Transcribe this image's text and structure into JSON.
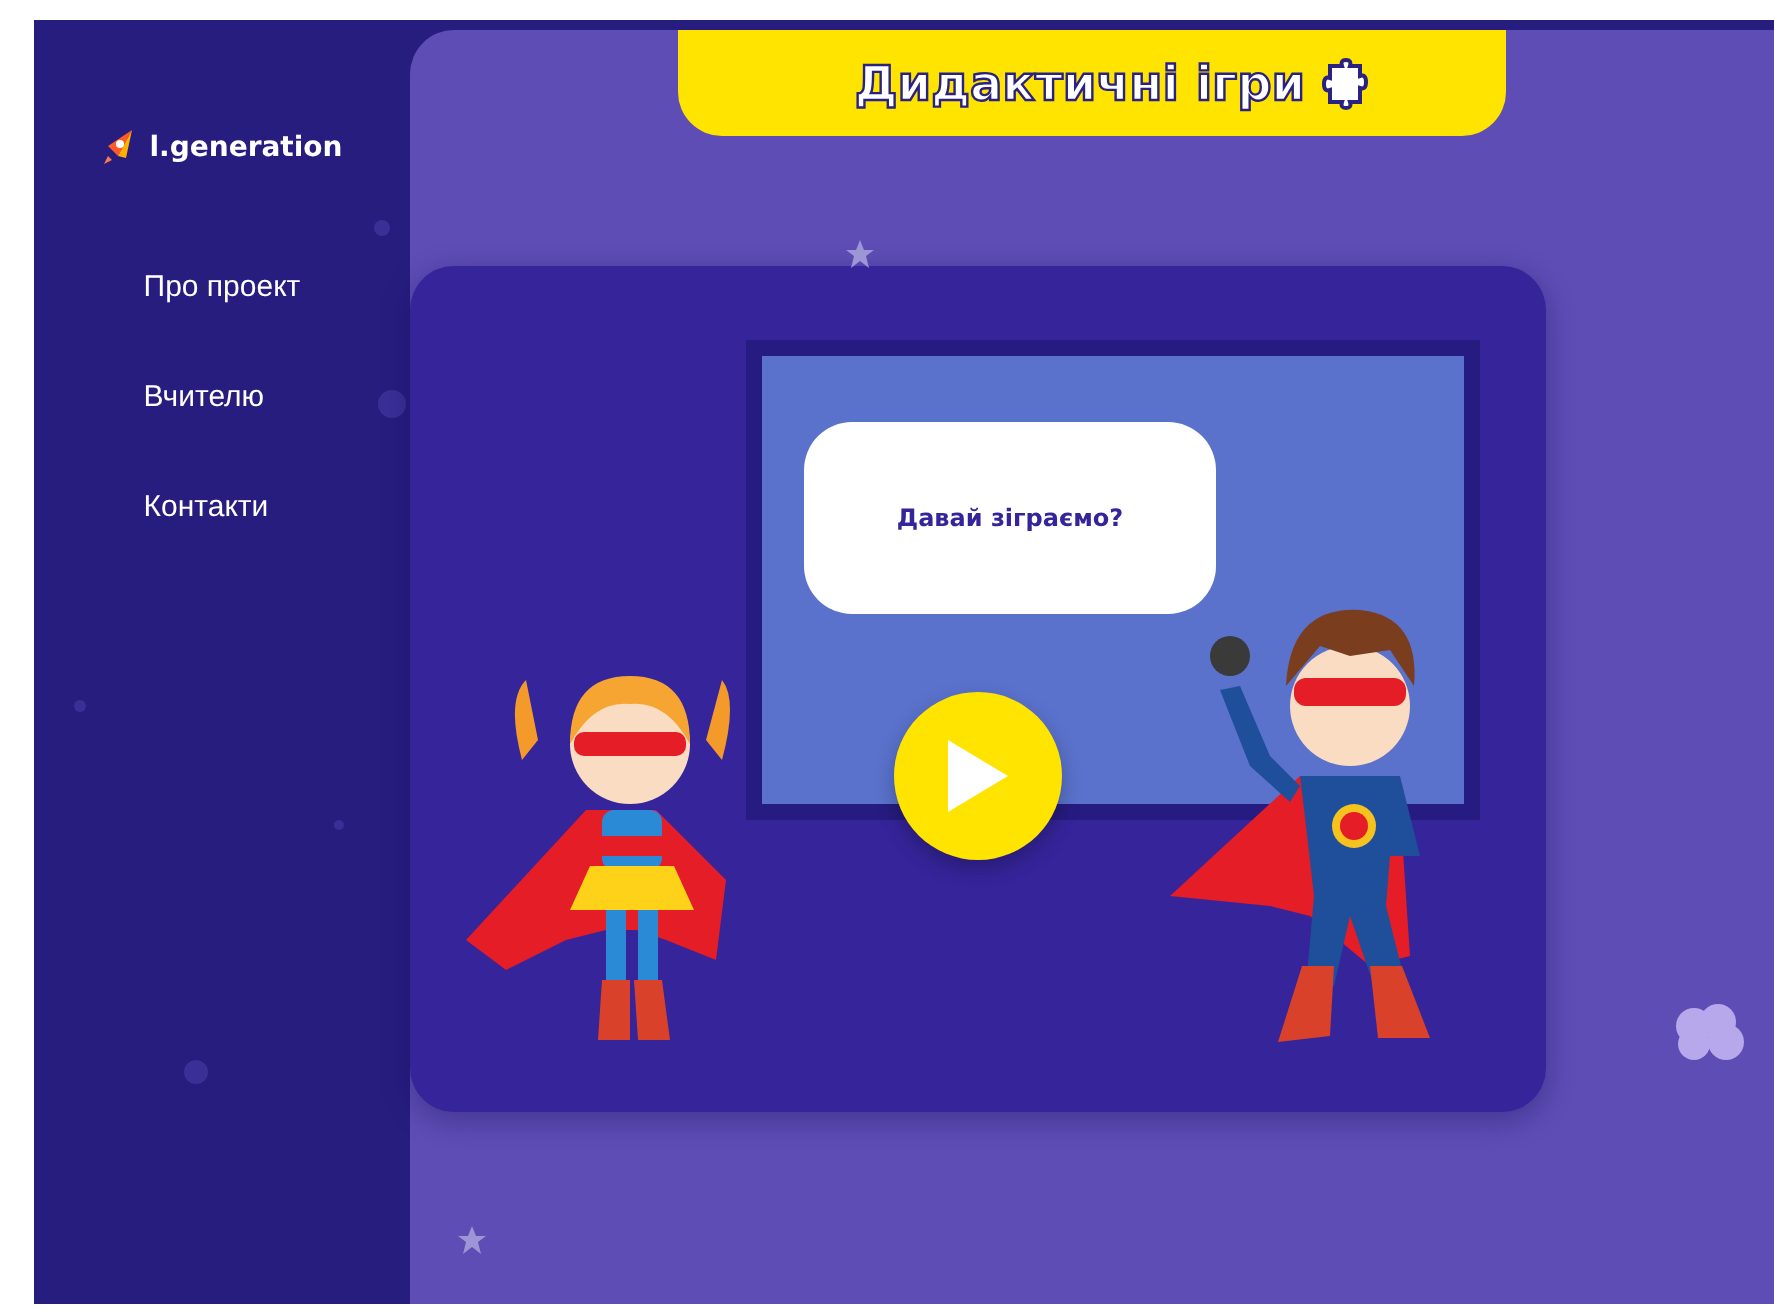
{
  "sidebar": {
    "logo": {
      "text": "l.generation"
    },
    "items": [
      {
        "label": "Про проект"
      },
      {
        "label": "Вчителю"
      },
      {
        "label": "Контакти"
      }
    ]
  },
  "header": {
    "title": "Дидактичні ігри"
  },
  "player": {
    "prompt": "Давай зіграємо?"
  }
}
